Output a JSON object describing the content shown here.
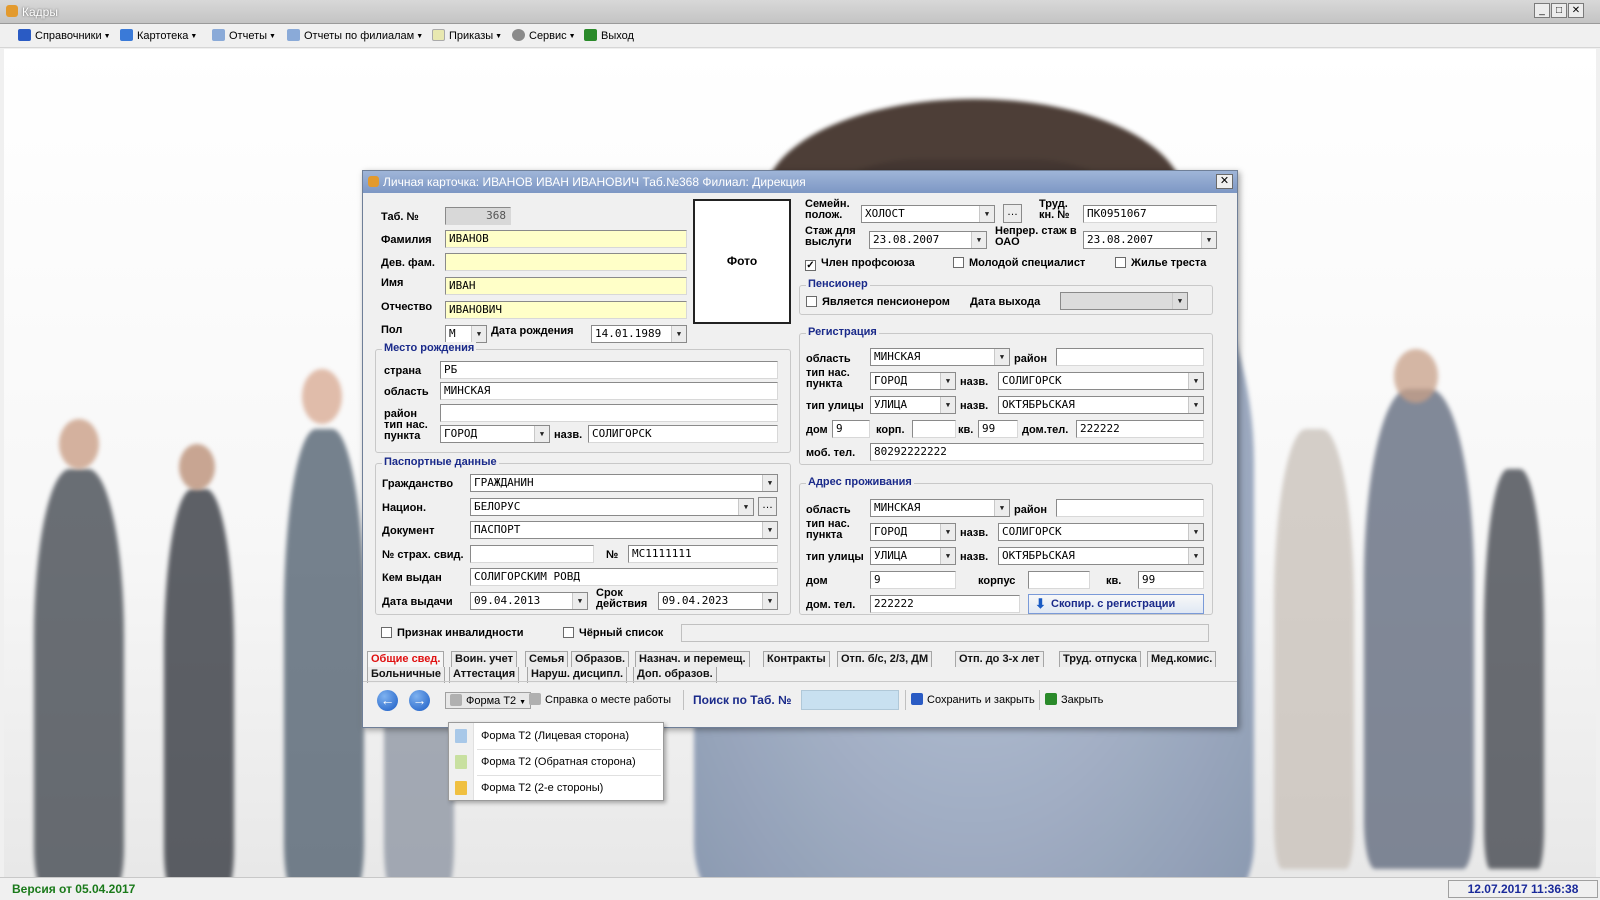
{
  "window": {
    "title": "Кадры",
    "min": "_",
    "max": "□",
    "close": "✕"
  },
  "menu": [
    {
      "label": "Справочники",
      "icon": "book-icon",
      "color": "#2a5bc4"
    },
    {
      "label": "Картотека",
      "icon": "people-icon",
      "color": "#3a7ad8"
    },
    {
      "label": "Отчеты",
      "icon": "document-icon",
      "color": "#8aaad8"
    },
    {
      "label": "Отчеты по филиалам",
      "icon": "document-icon",
      "color": "#8aaad8"
    },
    {
      "label": "Приказы",
      "icon": "page-icon",
      "color": "#e8e8b0"
    },
    {
      "label": "Сервис",
      "icon": "gear-icon",
      "color": "#8a8a8a"
    },
    {
      "label": "Выход",
      "icon": "exit-icon",
      "color": "#2a8a2a"
    }
  ],
  "status": {
    "version": "Версия от 05.04.2017",
    "datetime": "12.07.2017 11:36:38"
  },
  "dialog": {
    "title": "Личная карточка: ИВАНОВ ИВАН ИВАНОВИЧ Таб.№368 Филиал: Дирекция",
    "close": "✕",
    "photo": "Фото",
    "person": {
      "tab_label": "Таб. №",
      "tab_value": "368",
      "surname_label": "Фамилия",
      "surname": "ИВАНОВ",
      "maiden_label": "Дев. фам.",
      "maiden": "",
      "name_label": "Имя",
      "name": "ИВАН",
      "patronymic_label": "Отчество",
      "patronymic": "ИВАНОВИЧ",
      "sex_label": "Пол",
      "sex": "М",
      "birthdate_label": "Дата рождения",
      "birthdate": "14.01.1989"
    },
    "birthplace": {
      "title": "Место рождения",
      "country_label": "страна",
      "country": "РБ",
      "region_label": "область",
      "region": "МИНСКАЯ",
      "district_label": "район",
      "district": "",
      "settle_type_label": "тип нас. пункта",
      "settle_type": "ГОРОД",
      "settle_name_label": "назв.",
      "settle_name": "СОЛИГОРСК"
    },
    "passport": {
      "title": "Паспортные данные",
      "citizenship_label": "Гражданство",
      "citizenship": "ГРАЖДАНИН",
      "nation_label": "Национ.",
      "nation": "БЕЛОРУС",
      "document_label": "Документ",
      "document": "ПАСПОРТ",
      "insurance_label": "№ страх. свид.",
      "insurance": "",
      "number_label": "№",
      "number": "МС1111111",
      "issued_by_label": "Кем выдан",
      "issued_by": "СОЛИГОРСКИМ РОВД",
      "issue_date_label": "Дата выдачи",
      "issue_date": "09.04.2013",
      "valid_label": "Срок действия",
      "valid": "09.04.2023"
    },
    "disability_label": "Признак инвалидности",
    "blacklist_label": "Чёрный список",
    "family": {
      "status_label": "Семейн. полож.",
      "status": "ХОЛОСТ",
      "workbook_label": "Труд. кн. №",
      "workbook": "ПК0951067",
      "seniority_label": "Стаж для выслуги",
      "seniority": "23.08.2007",
      "continuous_label": "Непрер. стаж в ОАО",
      "continuous": "23.08.2007",
      "union_label": "Член профсоюза",
      "union_checked": "✓",
      "young_label": "Молодой специалист",
      "housing_label": "Жилье треста"
    },
    "pension": {
      "title": "Пенсионер",
      "is_pensioner_label": "Является пенсионером",
      "exit_date_label": "Дата выхода",
      "exit_date": ""
    },
    "registration": {
      "title": "Регистрация",
      "region_label": "область",
      "region": "МИНСКАЯ",
      "district_label": "район",
      "district": "",
      "settle_type_label": "тип нас. пункта",
      "settle_type": "ГОРОД",
      "settle_name_label": "назв.",
      "settle_name": "СОЛИГОРСК",
      "street_type_label": "тип улицы",
      "street_type": "УЛИЦА",
      "street_name_label": "назв.",
      "street_name": "ОКТЯБРЬСКАЯ",
      "house_label": "дом",
      "house": "9",
      "building_label": "корп.",
      "building": "",
      "flat_label": "кв.",
      "flat": "99",
      "home_phone_label": "дом.тел.",
      "home_phone": "222222",
      "mobile_label": "моб. тел.",
      "mobile": "80292222222"
    },
    "residence": {
      "title": "Адрес проживания",
      "region_label": "область",
      "region": "МИНСКАЯ",
      "district_label": "район",
      "district": "",
      "settle_type_label": "тип нас. пункта",
      "settle_type": "ГОРОД",
      "settle_name_label": "назв.",
      "settle_name": "СОЛИГОРСК",
      "street_type_label": "тип улицы",
      "street_type": "УЛИЦА",
      "street_name_label": "назв.",
      "street_name": "ОКТЯБРЬСКАЯ",
      "house_label": "дом",
      "house": "9",
      "building_label": "корпус",
      "building": "",
      "flat_label": "кв.",
      "flat": "99",
      "home_phone_label": "дом. тел.",
      "home_phone": "222222",
      "copy_button": "Скопир. с регистрации"
    },
    "tabs_row1": [
      "Общие свед.",
      "Воин. учет",
      "Семья",
      "Образов.",
      "Назнач. и перемещ.",
      "Контракты",
      "Отп. б/с, 2/3, ДМ",
      "Отп. до 3-х лет",
      "Труд. отпуска",
      "Мед.комис."
    ],
    "tabs_row2": [
      "Больничные",
      "Аттестация",
      "Наруш. дисципл.",
      "Доп. образов."
    ],
    "toolbar": {
      "back": "←",
      "forward": "→",
      "form_t2": "Форма Т2",
      "work_cert": "Справка о месте работы",
      "search_label": "Поиск по Таб. №",
      "search_value": "",
      "save_close": "Сохранить и закрыть",
      "close": "Закрыть"
    },
    "popup": [
      {
        "label": "Форма Т2 (Лицевая сторона)",
        "color": "#a8c8e8"
      },
      {
        "label": "Форма Т2 (Обратная сторона)",
        "color": "#c8e0a0"
      },
      {
        "label": "Форма Т2 (2-е стороны)",
        "color": "#f0c040"
      }
    ]
  }
}
